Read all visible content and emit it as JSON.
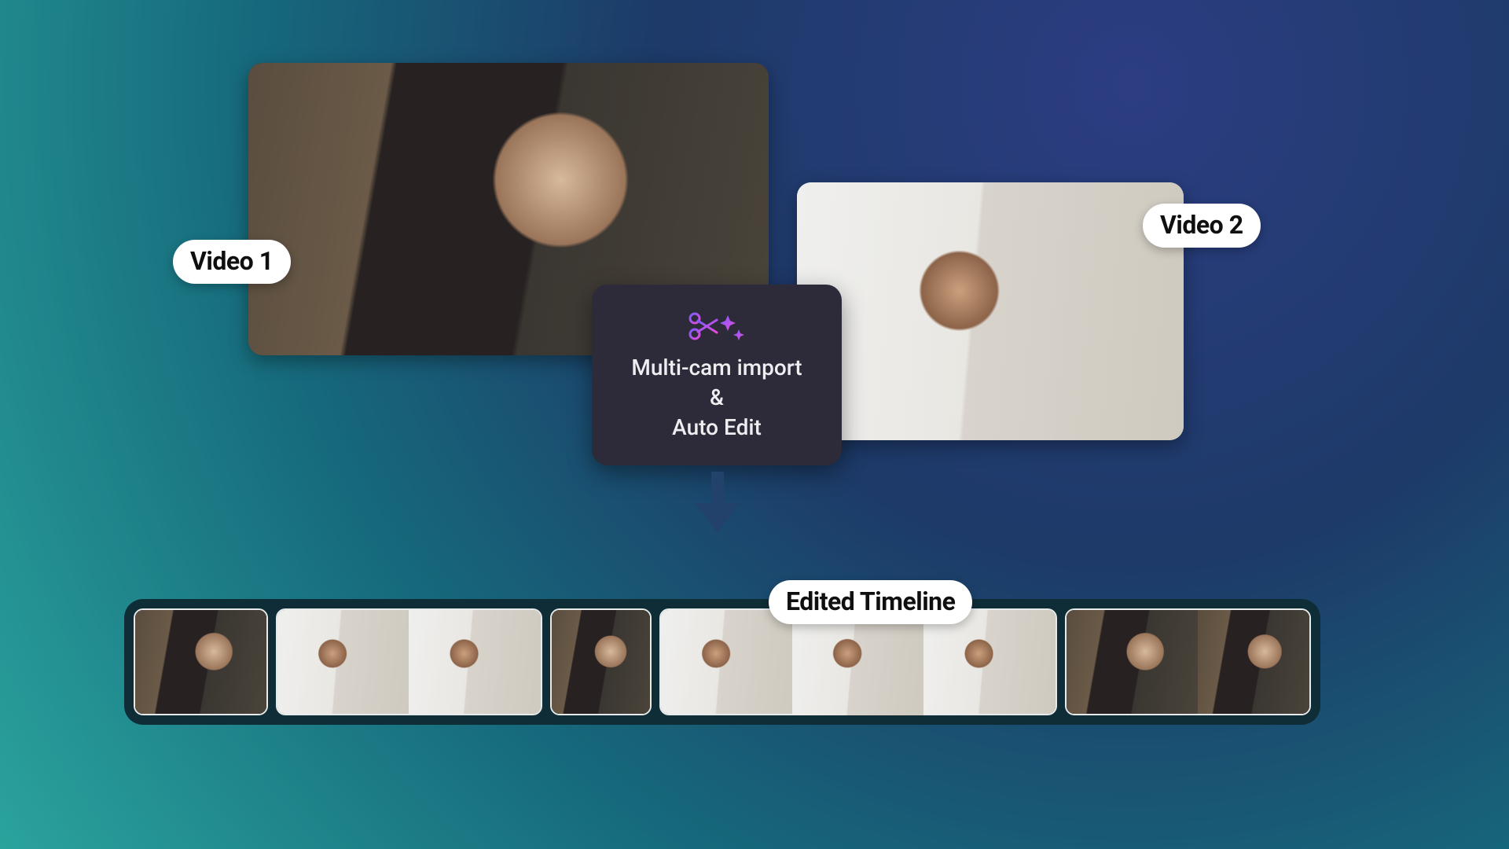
{
  "videos": {
    "v1_label": "Video 1",
    "v2_label": "Video 2"
  },
  "feature": {
    "line1": "Multi-cam import",
    "line2": "&",
    "line3": "Auto Edit"
  },
  "timeline": {
    "label": "Edited Timeline",
    "clips": [
      {
        "source": "v1"
      },
      {
        "source": "v2"
      },
      {
        "source": "v2"
      },
      {
        "source": "v1"
      },
      {
        "source": "v2"
      },
      {
        "source": "v2"
      },
      {
        "source": "v2"
      },
      {
        "source": "v1"
      },
      {
        "source": "v1"
      }
    ]
  }
}
